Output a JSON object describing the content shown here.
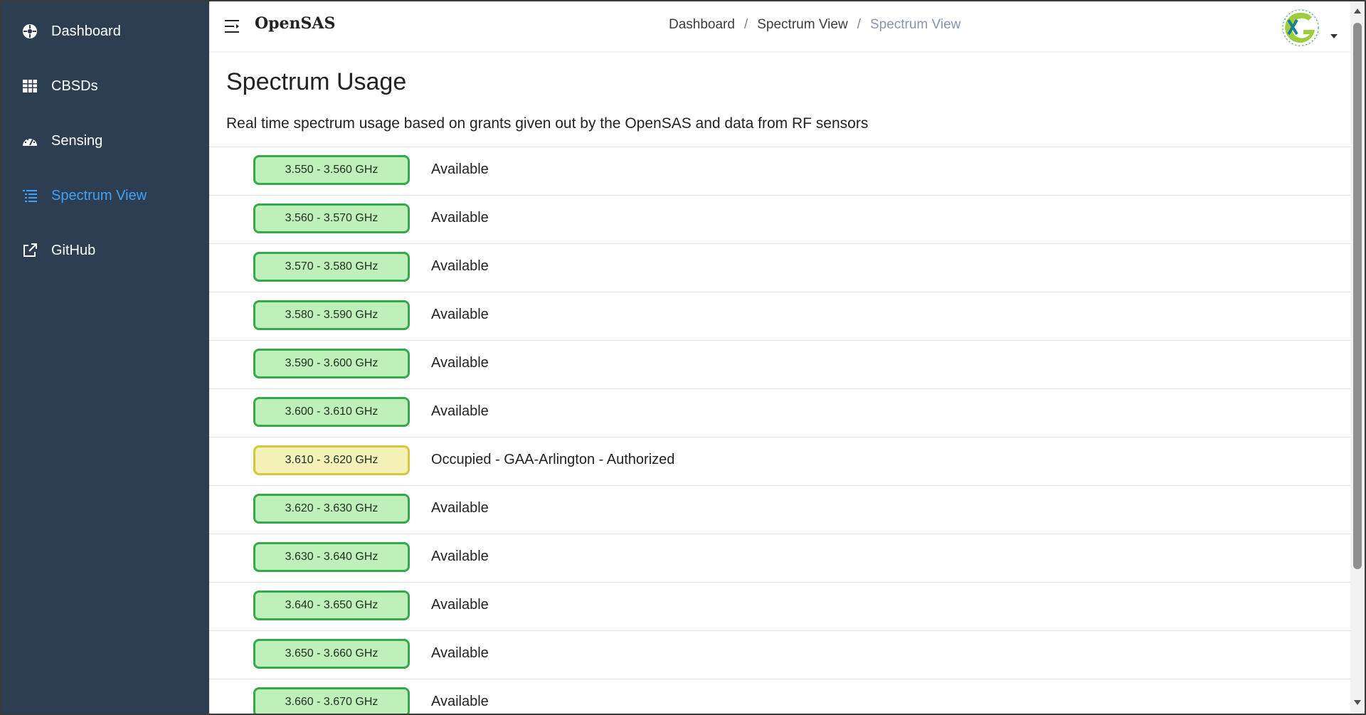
{
  "sidebar": {
    "items": [
      {
        "label": "Dashboard",
        "icon": "dashboard-icon"
      },
      {
        "label": "CBSDs",
        "icon": "grid-icon"
      },
      {
        "label": "Sensing",
        "icon": "gauge-icon"
      },
      {
        "label": "Spectrum View",
        "icon": "list-icon",
        "active": true
      },
      {
        "label": "GitHub",
        "icon": "external-link-icon"
      }
    ]
  },
  "header": {
    "brand": "OpenSAS",
    "breadcrumb": [
      "Dashboard",
      "Spectrum View",
      "Spectrum View"
    ],
    "separator": "/"
  },
  "page": {
    "title": "Spectrum Usage",
    "description": "Real time spectrum usage based on grants given out by the OpenSAS and data from RF sensors"
  },
  "bands": [
    {
      "range": "3.550 - 3.560 GHz",
      "status": "Available",
      "state": "available"
    },
    {
      "range": "3.560 - 3.570 GHz",
      "status": "Available",
      "state": "available"
    },
    {
      "range": "3.570 - 3.580 GHz",
      "status": "Available",
      "state": "available"
    },
    {
      "range": "3.580 - 3.590 GHz",
      "status": "Available",
      "state": "available"
    },
    {
      "range": "3.590 - 3.600 GHz",
      "status": "Available",
      "state": "available"
    },
    {
      "range": "3.600 - 3.610 GHz",
      "status": "Available",
      "state": "available"
    },
    {
      "range": "3.610 - 3.620 GHz",
      "status": "Occupied - GAA-Arlington - Authorized",
      "state": "occupied"
    },
    {
      "range": "3.620 - 3.630 GHz",
      "status": "Available",
      "state": "available"
    },
    {
      "range": "3.630 - 3.640 GHz",
      "status": "Available",
      "state": "available"
    },
    {
      "range": "3.640 - 3.650 GHz",
      "status": "Available",
      "state": "available"
    },
    {
      "range": "3.650 - 3.660 GHz",
      "status": "Available",
      "state": "available"
    },
    {
      "range": "3.660 - 3.670 GHz",
      "status": "Available",
      "state": "available"
    }
  ],
  "colors": {
    "sidebar_bg": "#2e3e52",
    "active_nav": "#3fa2f7",
    "available_bg": "#bff0b9",
    "available_border": "#36a94c",
    "occupied_bg": "#f3f1b7",
    "occupied_border": "#d3c941"
  }
}
